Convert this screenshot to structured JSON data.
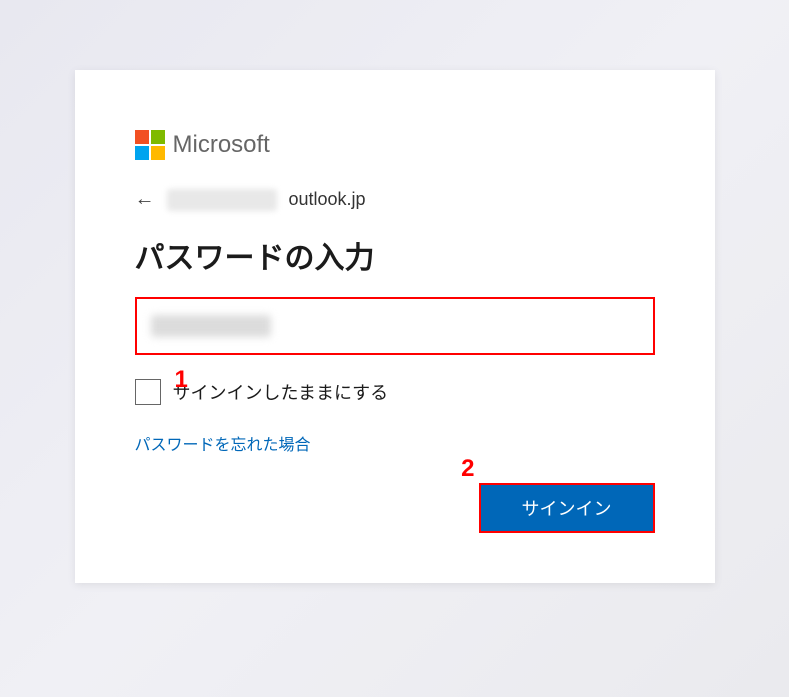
{
  "logo_text": "Microsoft",
  "identity": {
    "domain": "outlook.jp"
  },
  "heading": "パスワードの入力",
  "checkbox_label": "サインインしたままにする",
  "forgot_password": "パスワードを忘れた場合",
  "signin_button": "サインイン",
  "annotations": {
    "one": "1",
    "two": "2"
  }
}
